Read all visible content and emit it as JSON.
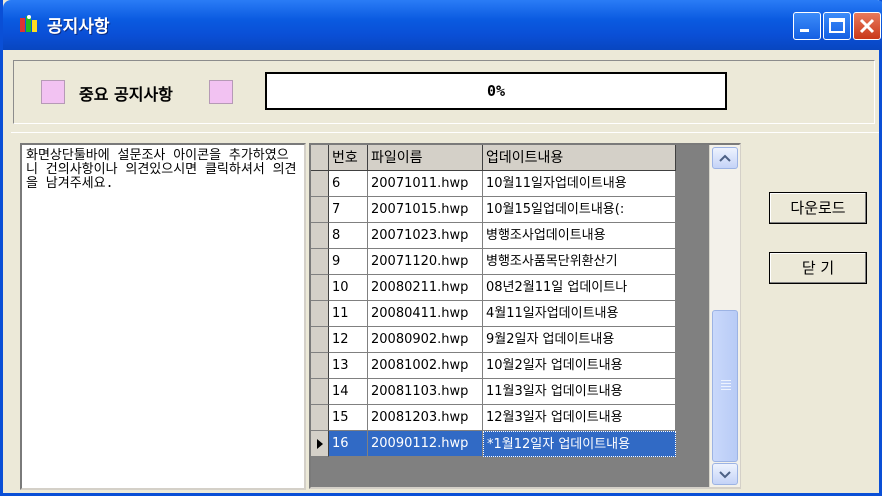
{
  "window": {
    "title": "공지사항",
    "icon": "app-icon",
    "controls": [
      "minimize-icon",
      "maximize-icon",
      "close-icon"
    ]
  },
  "header": {
    "important_label": "중요  공지사항",
    "progress_text": "0%",
    "progress_value": 0
  },
  "message": "화면상단툴바에 설문조사 아이콘을 추가하였으니 건의사항이나 의견있으시면 클릭하셔서 의견을 남겨주세요.",
  "table": {
    "columns": [
      "번호",
      "파일이름",
      "업데이트내용"
    ],
    "rows": [
      {
        "no": "6",
        "file": "20071011.hwp",
        "desc": "10월11일자업데이트내용"
      },
      {
        "no": "7",
        "file": "20071015.hwp",
        "desc": "10월15일업데이트내용(:"
      },
      {
        "no": "8",
        "file": "20071023.hwp",
        "desc": "병행조사업데이트내용"
      },
      {
        "no": "9",
        "file": "20071120.hwp",
        "desc": "병행조사품목단위환산기"
      },
      {
        "no": "10",
        "file": "20080211.hwp",
        "desc": "08년2월11일 업데이트나"
      },
      {
        "no": "11",
        "file": "20080411.hwp",
        "desc": "4월11일자업데이트내용"
      },
      {
        "no": "12",
        "file": "20080902.hwp",
        "desc": "9월2일자 업데이트내용"
      },
      {
        "no": "13",
        "file": "20081002.hwp",
        "desc": "10월2일자 업데이트내용"
      },
      {
        "no": "14",
        "file": "20081103.hwp",
        "desc": "11월3일자 업데이트내용"
      },
      {
        "no": "15",
        "file": "20081203.hwp",
        "desc": "12월3일자 업데이트내용"
      },
      {
        "no": "16",
        "file": "20090112.hwp",
        "desc": "*1월12일자 업데이트내용"
      }
    ],
    "selected_row": "16"
  },
  "buttons": {
    "download": "다운로드",
    "close": "닫 기"
  },
  "colors": {
    "titlebar": "#0a4fd6",
    "selection": "#316ac5",
    "pink_marker": "#f2c2f2"
  }
}
